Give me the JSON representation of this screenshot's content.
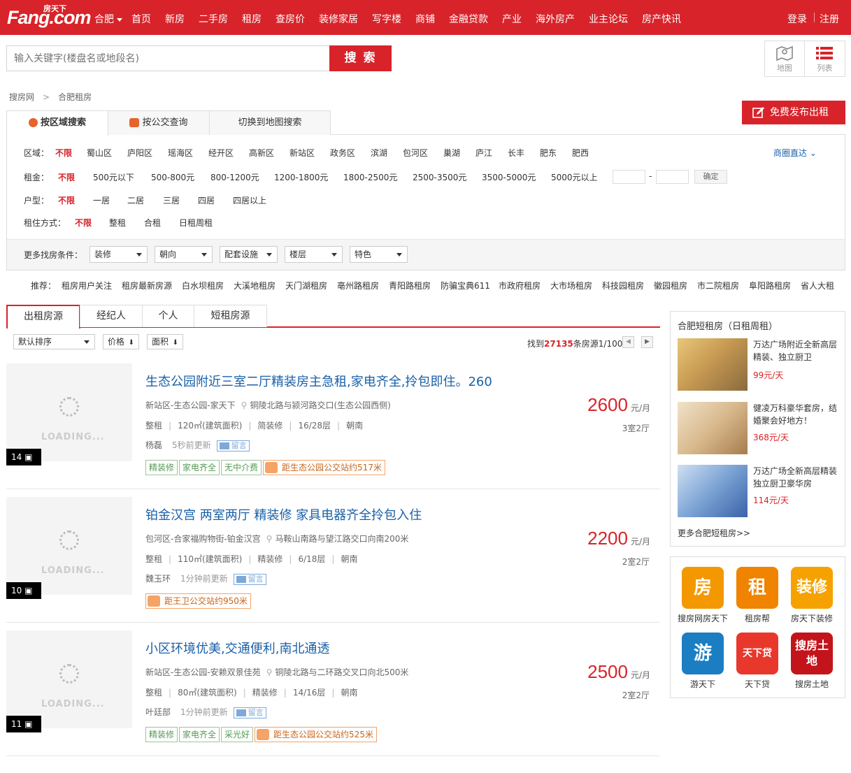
{
  "header": {
    "logo_cn": "房天下",
    "logo_en": "Fang.com",
    "city": "合肥",
    "nav": [
      "首页",
      "新房",
      "二手房",
      "租房",
      "查房价",
      "装修家居",
      "写字楼",
      "商铺",
      "金融贷款",
      "产业",
      "海外房产",
      "业主论坛",
      "房产快讯"
    ],
    "login": "登录",
    "register": "注册"
  },
  "search": {
    "placeholder": "输入关键字(楼盘名或地段名)",
    "button": "搜 索"
  },
  "view_toggle": {
    "map": "地图",
    "list": "列表"
  },
  "breadcrumb": [
    "搜房网",
    ">",
    "合肥租房"
  ],
  "publish_button": "免费发布出租",
  "search_tabs": [
    "按区域搜索",
    "按公交查询",
    "切换到地图搜索"
  ],
  "filters": {
    "district": {
      "label": "区域：",
      "options": [
        "不限",
        "蜀山区",
        "庐阳区",
        "瑶海区",
        "经开区",
        "高新区",
        "新站区",
        "政务区",
        "滨湖",
        "包河区",
        "巢湖",
        "庐江",
        "长丰",
        "肥东",
        "肥西"
      ],
      "extra": "商圈直达"
    },
    "rent": {
      "label": "租金：",
      "options": [
        "不限",
        "500元以下",
        "500-800元",
        "800-1200元",
        "1200-1800元",
        "1800-2500元",
        "2500-3500元",
        "3500-5000元",
        "5000元以上"
      ],
      "dash": "-",
      "ok": "确定"
    },
    "layout": {
      "label": "户型：",
      "options": [
        "不限",
        "一居",
        "二居",
        "三居",
        "四居",
        "四居以上"
      ]
    },
    "mode": {
      "label": "租住方式：",
      "options": [
        "不限",
        "整租",
        "合租",
        "日租周租"
      ]
    }
  },
  "more_filters": {
    "label": "更多找房条件：",
    "dropdowns": [
      "装修",
      "朝向",
      "配套设施",
      "楼层",
      "特色"
    ]
  },
  "recommend": {
    "label": "推荐：",
    "items": [
      "租房用户关注",
      "租房最新房源",
      "白水坝租房",
      "大溪地租房",
      "天门湖租房",
      "亳州路租房",
      "青阳路租房",
      "防骗宝典611",
      "市政府租房",
      "大市场租房",
      "科技园租房",
      "徽园租房",
      "市二院租房",
      "阜阳路租房",
      "省人大租"
    ]
  },
  "list_tabs": [
    "出租房源",
    "经纪人",
    "个人",
    "短租房源"
  ],
  "sort": {
    "default": "默认排序",
    "price": "价格",
    "area": "面积"
  },
  "found": {
    "prefix": "找到",
    "count": "27135",
    "suffix": "条房源1/100"
  },
  "listings": [
    {
      "title": "生态公园附近三室二厅精装房主急租,家电齐全,拎包即住。260",
      "district": "新站区-生态公园-家天下",
      "address": "铜陵北路与颍河路交口(生态公园西侧)",
      "specs": [
        "整租",
        "120㎡(建筑面积)",
        "简装修",
        "16/28层",
        "朝南"
      ],
      "agent": "杨磊",
      "updated": "5秒前更新",
      "message": "留言",
      "tags": [
        "精装修",
        "家电齐全",
        "无中介费"
      ],
      "bus": "距生态公园公交站约517米",
      "price": "2600",
      "unit": "元/月",
      "type": "3室2厅",
      "photos": "14",
      "loading": "LOADING..."
    },
    {
      "title": "铂金汉宫 两室两厅 精装修 家具电器齐全拎包入住",
      "district": "包河区-合家福购物街-铂金汉宫",
      "address": "马鞍山南路与望江路交口向南200米",
      "specs": [
        "整租",
        "110㎡(建筑面积)",
        "精装修",
        "6/18层",
        "朝南"
      ],
      "agent": "魏玉环",
      "updated": "1分钟前更新",
      "message": "留言",
      "tags": [],
      "bus": "距王卫公交站约950米",
      "price": "2200",
      "unit": "元/月",
      "type": "2室2厅",
      "photos": "10",
      "loading": "LOADING..."
    },
    {
      "title": "小区环境优美,交通便利,南北通透",
      "district": "新站区-生态公园-安赖双景佳苑",
      "address": "铜陵北路与二环路交叉口向北500米",
      "specs": [
        "整租",
        "80㎡(建筑面积)",
        "精装修",
        "14/16层",
        "朝南"
      ],
      "agent": "叶廷部",
      "updated": "1分钟前更新",
      "message": "留言",
      "tags": [
        "精装修",
        "家电齐全",
        "采光好"
      ],
      "bus": "距生态公园公交站约525米",
      "price": "2500",
      "unit": "元/月",
      "type": "2室2厅",
      "photos": "11",
      "loading": "LOADING..."
    }
  ],
  "short_rent": {
    "title": "合肥短租房（日租周租）",
    "items": [
      {
        "title": "万达广场附近全新高层精装、独立厨卫",
        "price": "99元/天"
      },
      {
        "title": "健凌万科豪华套房，结婚聚会好地方！",
        "price": "368元/天"
      },
      {
        "title": "万达广场全新高层精装独立厨卫豪华房",
        "price": "114元/天"
      }
    ],
    "more": "更多合肥短租房>>"
  },
  "apps": [
    {
      "name": "搜房网房天下",
      "glyph": "房",
      "color": "#f39800"
    },
    {
      "name": "租房帮",
      "glyph": "租",
      "color": "#f08300"
    },
    {
      "name": "房天下装修",
      "glyph": "装修",
      "color": "#f5a200"
    },
    {
      "name": "游天下",
      "glyph": "游",
      "color": "#1b7ec2"
    },
    {
      "name": "天下贷",
      "glyph": "天下贷",
      "color": "#e8382c"
    },
    {
      "name": "搜房土地",
      "glyph": "搜房土地",
      "color": "#c4141b"
    }
  ]
}
